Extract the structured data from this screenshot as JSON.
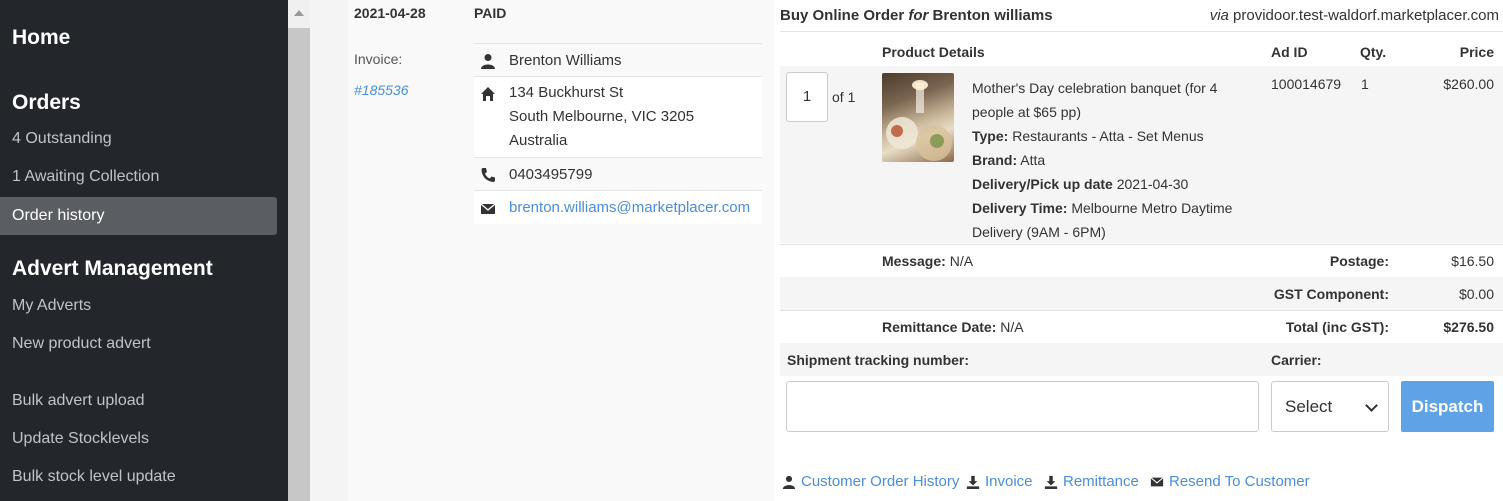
{
  "sidebar": {
    "home": "Home",
    "orders_heading": "Orders",
    "outstanding": "4 Outstanding",
    "awaiting": "1 Awaiting Collection",
    "order_history": "Order history",
    "advert_heading": "Advert Management",
    "my_adverts": "My Adverts",
    "new_product_advert": "New product advert",
    "bulk_upload": "Bulk advert upload",
    "update_stock": "Update Stocklevels",
    "bulk_stock": "Bulk stock level update"
  },
  "order": {
    "date": "2021-04-28",
    "status": "PAID",
    "invoice_label": "Invoice:",
    "invoice_number": "#185536"
  },
  "customer": {
    "name": "Brenton Williams",
    "address_line1": "134 Buckhurst St",
    "address_line2": "South Melbourne, VIC 3205",
    "address_line3": "Australia",
    "phone": "0403495799",
    "email": "brenton.williams@marketplacer.com"
  },
  "header": {
    "prefix": "Buy Online Order",
    "for": "for",
    "customer": "Brenton williams",
    "via_label": "via",
    "via_site": "providoor.test-waldorf.marketplacer.com"
  },
  "table": {
    "col_product": "Product Details",
    "col_ad_id": "Ad ID",
    "col_qty": "Qty.",
    "col_price": "Price"
  },
  "item": {
    "qty_input": "1",
    "of_label": "of 1",
    "title_line1": "Mother's Day celebration banquet (for 4",
    "title_line2": "people at $65 pp)",
    "type_label": "Type:",
    "type_value": "Restaurants - Atta - Set Menus",
    "brand_label": "Brand:",
    "brand_value": "Atta",
    "delivery_date_label": "Delivery/Pick up date",
    "delivery_date_value": "2021-04-30",
    "delivery_time_label": "Delivery Time:",
    "delivery_time_value_line1": "Melbourne Metro Daytime",
    "delivery_time_value_line2": "Delivery (9AM - 6PM)",
    "ad_id": "100014679",
    "qty": "1",
    "price": "$260.00"
  },
  "totals": {
    "message_label": "Message:",
    "message_value": "N/A",
    "postage_label": "Postage:",
    "postage_value": "$16.50",
    "gst_label": "GST Component:",
    "gst_value": "$0.00",
    "remittance_label": "Remittance Date:",
    "remittance_value": "N/A",
    "total_label": "Total (inc GST):",
    "total_value": "$276.50"
  },
  "shipment": {
    "tracking_label": "Shipment tracking number:",
    "tracking_value": "",
    "carrier_label": "Carrier:",
    "carrier_selected": "Select",
    "dispatch_label": "Dispatch"
  },
  "footer": {
    "customer_history": "Customer Order History",
    "invoice": "Invoice",
    "remittance": "Remittance",
    "resend": "Resend To Customer"
  },
  "colors": {
    "sidebar_bg": "#23272b",
    "link": "#4a8fd8",
    "dispatch_bg": "#5fa3e6"
  }
}
